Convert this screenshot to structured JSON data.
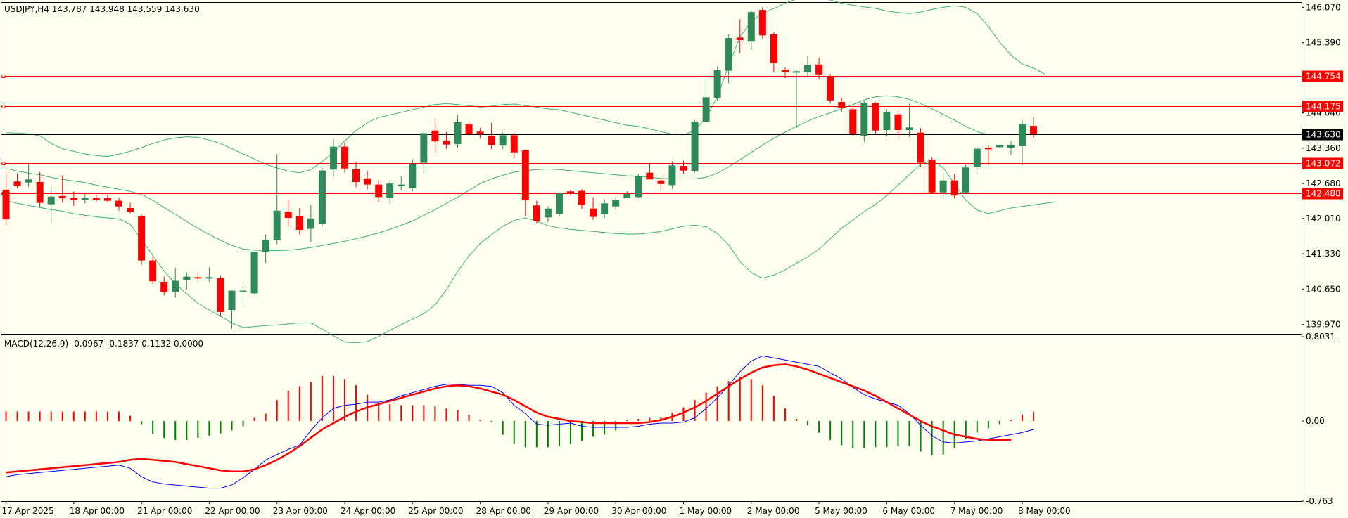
{
  "colors": {
    "background": "#fffff0",
    "bull": "#2e8b57",
    "bear": "#ff0000",
    "bands": "#3cb371",
    "hline": "#ff0000",
    "price_line": "#000000",
    "macd_line": "#0000ff",
    "signal_line": "#ff0000",
    "hist_pos": "#ff0000",
    "hist_neg": "#008000"
  },
  "chart_data": [
    {
      "type": "candlestick",
      "title": "USDJPY,H4  143.787 143.948 143.559 143.630",
      "ylim": [
        139.79,
        146.17
      ],
      "yticks": [
        146.07,
        145.39,
        144.04,
        143.36,
        142.68,
        142.01,
        141.33,
        140.65,
        139.97
      ],
      "ytick_labels": [
        "146.070",
        "145.390",
        "144.040",
        "143.360",
        "142.680",
        "142.010",
        "141.330",
        "140.650",
        "139.970"
      ],
      "horizontal_levels": [
        {
          "value": 144.754,
          "label": "144.754"
        },
        {
          "value": 144.175,
          "label": "144.175"
        },
        {
          "value": 143.072,
          "label": "143.072"
        },
        {
          "value": 142.488,
          "label": "142.488"
        }
      ],
      "current_price": {
        "value": 143.63,
        "label": "143.630"
      },
      "candles": [
        [
          142.56,
          142.92,
          141.88,
          141.99
        ],
        [
          142.72,
          142.88,
          142.59,
          142.64
        ],
        [
          142.7,
          143.05,
          142.61,
          142.76
        ],
        [
          142.71,
          142.9,
          142.23,
          142.31
        ],
        [
          142.28,
          142.62,
          141.92,
          142.43
        ],
        [
          142.44,
          142.84,
          142.31,
          142.4
        ],
        [
          142.4,
          142.53,
          142.25,
          142.37
        ],
        [
          142.37,
          142.49,
          142.3,
          142.4
        ],
        [
          142.4,
          142.47,
          142.32,
          142.36
        ],
        [
          142.4,
          142.46,
          142.32,
          142.35
        ],
        [
          142.35,
          142.41,
          142.16,
          142.24
        ],
        [
          142.21,
          142.31,
          142.11,
          142.14
        ],
        [
          142.06,
          142.1,
          141.11,
          141.2
        ],
        [
          141.2,
          141.28,
          140.75,
          140.8
        ],
        [
          140.79,
          140.89,
          140.53,
          140.59
        ],
        [
          140.6,
          141.05,
          140.49,
          140.81
        ],
        [
          140.83,
          140.98,
          140.64,
          140.89
        ],
        [
          140.88,
          140.97,
          140.8,
          140.87
        ],
        [
          140.86,
          141.07,
          140.79,
          140.88
        ],
        [
          140.86,
          140.92,
          140.14,
          140.21
        ],
        [
          140.25,
          140.63,
          139.89,
          140.62
        ],
        [
          140.61,
          140.71,
          140.3,
          140.62
        ],
        [
          140.57,
          141.37,
          140.55,
          141.36
        ],
        [
          141.37,
          141.7,
          141.15,
          141.6
        ],
        [
          141.59,
          143.25,
          141.51,
          142.16
        ],
        [
          142.14,
          142.36,
          141.85,
          142.02
        ],
        [
          142.06,
          142.21,
          141.7,
          141.79
        ],
        [
          141.81,
          142.27,
          141.56,
          142.01
        ],
        [
          141.9,
          142.98,
          141.85,
          142.93
        ],
        [
          142.95,
          143.53,
          142.81,
          143.39
        ],
        [
          143.39,
          143.46,
          142.89,
          142.97
        ],
        [
          142.96,
          143.1,
          142.61,
          142.71
        ],
        [
          142.78,
          142.92,
          142.57,
          142.66
        ],
        [
          142.66,
          142.75,
          142.33,
          142.42
        ],
        [
          142.4,
          142.74,
          142.3,
          142.68
        ],
        [
          142.65,
          142.82,
          142.55,
          142.66
        ],
        [
          142.59,
          143.15,
          142.53,
          143.06
        ],
        [
          143.08,
          143.7,
          142.88,
          143.65
        ],
        [
          143.7,
          143.92,
          143.27,
          143.49
        ],
        [
          143.51,
          143.67,
          143.35,
          143.43
        ],
        [
          143.44,
          144.0,
          143.37,
          143.86
        ],
        [
          143.82,
          143.87,
          143.61,
          143.63
        ],
        [
          143.68,
          143.75,
          143.55,
          143.64
        ],
        [
          143.6,
          143.85,
          143.34,
          143.42
        ],
        [
          143.41,
          143.66,
          143.34,
          143.61
        ],
        [
          143.61,
          143.65,
          143.17,
          143.28
        ],
        [
          143.32,
          143.33,
          142.05,
          142.36
        ],
        [
          142.26,
          142.35,
          141.92,
          141.96
        ],
        [
          142.03,
          142.24,
          141.94,
          142.2
        ],
        [
          142.1,
          142.51,
          142.04,
          142.49
        ],
        [
          142.53,
          142.56,
          142.45,
          142.51
        ],
        [
          142.54,
          142.57,
          142.19,
          142.27
        ],
        [
          142.2,
          142.41,
          141.98,
          142.04
        ],
        [
          142.09,
          142.38,
          142.02,
          142.3
        ],
        [
          142.24,
          142.43,
          142.17,
          142.37
        ],
        [
          142.4,
          142.53,
          142.41,
          142.48
        ],
        [
          142.42,
          142.86,
          142.41,
          142.82
        ],
        [
          142.89,
          143.08,
          142.76,
          142.76
        ],
        [
          142.74,
          142.78,
          142.55,
          142.67
        ],
        [
          142.65,
          143.11,
          142.58,
          143.03
        ],
        [
          143.02,
          143.12,
          142.87,
          142.93
        ],
        [
          142.92,
          143.9,
          142.89,
          143.87
        ],
        [
          143.87,
          144.73,
          143.86,
          144.34
        ],
        [
          144.33,
          144.93,
          144.26,
          144.86
        ],
        [
          144.85,
          145.55,
          144.61,
          145.48
        ],
        [
          145.49,
          145.84,
          145.19,
          145.44
        ],
        [
          145.41,
          146.0,
          145.25,
          145.98
        ],
        [
          146.02,
          146.07,
          145.46,
          145.53
        ],
        [
          145.55,
          145.59,
          144.82,
          145.0
        ],
        [
          144.87,
          144.91,
          144.71,
          144.82
        ],
        [
          144.82,
          144.87,
          143.75,
          144.84
        ],
        [
          144.82,
          145.13,
          144.73,
          144.96
        ],
        [
          144.97,
          145.1,
          144.68,
          144.78
        ],
        [
          144.74,
          144.79,
          144.22,
          144.28
        ],
        [
          144.25,
          144.33,
          144.06,
          144.14
        ],
        [
          144.11,
          144.14,
          143.6,
          143.64
        ],
        [
          143.6,
          144.27,
          143.48,
          144.24
        ],
        [
          144.23,
          144.25,
          143.62,
          143.7
        ],
        [
          143.71,
          144.11,
          143.59,
          144.06
        ],
        [
          144.01,
          144.09,
          143.58,
          143.71
        ],
        [
          143.71,
          144.21,
          143.58,
          143.76
        ],
        [
          143.66,
          143.74,
          143.0,
          143.08
        ],
        [
          143.14,
          143.18,
          142.49,
          142.51
        ],
        [
          142.51,
          142.87,
          142.38,
          142.74
        ],
        [
          142.74,
          142.87,
          142.4,
          142.45
        ],
        [
          142.51,
          143.04,
          142.48,
          142.99
        ],
        [
          143.0,
          143.39,
          142.93,
          143.35
        ],
        [
          143.37,
          143.41,
          143.04,
          143.34
        ],
        [
          143.38,
          143.39,
          143.36,
          143.42
        ],
        [
          143.37,
          143.51,
          143.23,
          143.42
        ],
        [
          143.4,
          143.89,
          143.03,
          143.83
        ],
        [
          143.79,
          143.95,
          143.56,
          143.63
        ]
      ],
      "bollinger": {
        "upper": [
          143.66,
          143.65,
          143.64,
          143.6,
          143.45,
          143.35,
          143.3,
          143.25,
          143.22,
          143.2,
          143.25,
          143.3,
          143.37,
          143.45,
          143.52,
          143.56,
          143.58,
          143.57,
          143.52,
          143.45,
          143.35,
          143.25,
          143.15,
          143.05,
          142.98,
          142.92,
          142.89,
          142.95,
          143.1,
          143.28,
          143.5,
          143.7,
          143.85,
          143.95,
          144.0,
          144.05,
          144.1,
          144.15,
          144.2,
          144.22,
          144.2,
          144.18,
          144.15,
          144.17,
          144.2,
          144.21,
          144.18,
          144.15,
          144.12,
          144.1,
          144.05,
          144.0,
          143.95,
          143.9,
          143.85,
          143.8,
          143.78,
          143.73,
          143.68,
          143.63,
          143.62,
          143.7,
          143.95,
          144.35,
          144.95,
          145.5,
          145.8,
          145.96,
          146.05,
          146.15,
          146.23,
          146.25,
          146.25,
          146.21,
          146.15,
          146.11,
          146.08,
          146.05,
          146.0,
          145.97,
          145.95,
          145.98,
          146.03,
          146.07,
          146.1,
          146.07,
          145.95,
          145.7,
          145.4,
          145.15,
          144.98,
          144.9,
          144.79
        ],
        "middle": [
          142.97,
          142.92,
          142.88,
          142.85,
          142.8,
          142.76,
          142.73,
          142.7,
          142.65,
          142.61,
          142.57,
          142.53,
          142.47,
          142.36,
          142.22,
          142.09,
          141.95,
          141.82,
          141.7,
          141.59,
          141.49,
          141.42,
          141.4,
          141.39,
          141.39,
          141.4,
          141.42,
          141.45,
          141.49,
          141.53,
          141.57,
          141.62,
          141.67,
          141.73,
          141.8,
          141.88,
          141.96,
          142.07,
          142.18,
          142.3,
          142.42,
          142.55,
          142.68,
          142.77,
          142.84,
          142.9,
          142.93,
          142.95,
          142.96,
          142.95,
          142.93,
          142.91,
          142.89,
          142.87,
          142.85,
          142.83,
          142.82,
          142.8,
          142.78,
          142.77,
          142.77,
          142.77,
          142.8,
          142.88,
          143.0,
          143.14,
          143.28,
          143.42,
          143.55,
          143.67,
          143.78,
          143.88,
          143.97,
          144.04,
          144.12,
          144.2,
          144.29,
          144.35,
          144.37,
          144.35,
          144.3,
          144.22,
          144.12,
          144.01,
          143.9,
          143.78,
          143.68,
          143.62
        ],
        "lower": [
          142.36,
          142.3,
          142.26,
          142.22,
          142.18,
          142.15,
          142.1,
          142.07,
          142.04,
          142.02,
          142.0,
          141.9,
          141.6,
          141.3,
          141.0,
          140.75,
          140.56,
          140.38,
          140.25,
          140.13,
          140.0,
          139.91,
          139.93,
          139.95,
          139.96,
          139.98,
          140.0,
          140.0,
          139.88,
          139.75,
          139.63,
          139.62,
          139.64,
          139.74,
          139.86,
          139.97,
          140.07,
          140.18,
          140.35,
          140.64,
          140.99,
          141.29,
          141.53,
          141.7,
          141.86,
          141.97,
          142.02,
          141.96,
          141.87,
          141.83,
          141.8,
          141.78,
          141.76,
          141.74,
          141.72,
          141.71,
          141.71,
          141.73,
          141.76,
          141.81,
          141.86,
          141.88,
          141.85,
          141.72,
          141.5,
          141.18,
          140.97,
          140.86,
          140.92,
          141.02,
          141.15,
          141.27,
          141.42,
          141.62,
          141.82,
          141.98,
          142.14,
          142.28,
          142.45,
          142.65,
          142.85,
          143.05,
          143.13,
          142.98,
          142.68,
          142.36,
          142.17,
          142.1,
          142.16,
          142.21,
          142.24,
          142.27,
          142.3,
          142.33
        ]
      }
    },
    {
      "type": "macd",
      "title": "MACD(12,26,9) -0.0967 -0.1837 0.1132 0.0000",
      "ylim": [
        -0.763,
        0.8031
      ],
      "yticks": [
        0.8031,
        0.0,
        -0.763
      ],
      "ytick_labels": [
        "0.8031",
        "0.00",
        "-0.763"
      ],
      "histogram": [
        0.09,
        0.09,
        0.09,
        0.09,
        0.09,
        0.09,
        0.09,
        0.09,
        0.09,
        0.09,
        0.09,
        0.05,
        -0.03,
        -0.12,
        -0.16,
        -0.18,
        -0.18,
        -0.16,
        -0.14,
        -0.12,
        -0.09,
        -0.05,
        0.03,
        0.07,
        0.2,
        0.29,
        0.33,
        0.37,
        0.43,
        0.43,
        0.4,
        0.34,
        0.25,
        0.17,
        0.16,
        0.15,
        0.15,
        0.15,
        0.14,
        0.12,
        0.1,
        0.06,
        0.01,
        -0.01,
        -0.13,
        -0.22,
        -0.25,
        -0.25,
        -0.25,
        -0.24,
        -0.22,
        -0.19,
        -0.15,
        -0.13,
        -0.09,
        0.01,
        0.02,
        0.03,
        0.04,
        0.08,
        0.13,
        0.2,
        0.27,
        0.33,
        0.38,
        0.42,
        0.4,
        0.34,
        0.24,
        0.12,
        0.02,
        -0.04,
        -0.11,
        -0.18,
        -0.23,
        -0.26,
        -0.26,
        -0.25,
        -0.25,
        -0.24,
        -0.24,
        -0.29,
        -0.33,
        -0.32,
        -0.26,
        -0.17,
        -0.11,
        -0.07,
        -0.03,
        0.01,
        0.06,
        0.09
      ],
      "macd": [
        -0.53,
        -0.51,
        -0.5,
        -0.49,
        -0.48,
        -0.47,
        -0.46,
        -0.45,
        -0.44,
        -0.43,
        -0.42,
        -0.45,
        -0.53,
        -0.58,
        -0.6,
        -0.61,
        -0.62,
        -0.63,
        -0.64,
        -0.64,
        -0.61,
        -0.54,
        -0.46,
        -0.37,
        -0.32,
        -0.27,
        -0.23,
        -0.09,
        0.03,
        0.12,
        0.15,
        0.16,
        0.18,
        0.18,
        0.2,
        0.24,
        0.27,
        0.3,
        0.33,
        0.35,
        0.35,
        0.34,
        0.34,
        0.33,
        0.27,
        0.15,
        0.07,
        -0.03,
        -0.04,
        -0.03,
        -0.02,
        -0.05,
        -0.06,
        -0.06,
        -0.06,
        -0.06,
        -0.05,
        -0.03,
        -0.02,
        -0.02,
        -0.01,
        0.03,
        0.12,
        0.22,
        0.34,
        0.47,
        0.57,
        0.62,
        0.6,
        0.58,
        0.56,
        0.54,
        0.52,
        0.46,
        0.4,
        0.32,
        0.25,
        0.21,
        0.18,
        0.15,
        0.07,
        -0.04,
        -0.14,
        -0.2,
        -0.21,
        -0.2,
        -0.19,
        -0.17,
        -0.15,
        -0.13,
        -0.11,
        -0.08
      ],
      "signal": [
        -0.49,
        -0.48,
        -0.47,
        -0.46,
        -0.45,
        -0.44,
        -0.43,
        -0.42,
        -0.41,
        -0.4,
        -0.39,
        -0.37,
        -0.36,
        -0.37,
        -0.38,
        -0.39,
        -0.41,
        -0.43,
        -0.45,
        -0.47,
        -0.48,
        -0.48,
        -0.46,
        -0.42,
        -0.37,
        -0.31,
        -0.24,
        -0.16,
        -0.08,
        -0.02,
        0.04,
        0.09,
        0.13,
        0.16,
        0.19,
        0.22,
        0.25,
        0.28,
        0.31,
        0.33,
        0.34,
        0.33,
        0.31,
        0.28,
        0.25,
        0.2,
        0.14,
        0.08,
        0.04,
        0.02,
        0.0,
        -0.01,
        -0.02,
        -0.02,
        -0.02,
        -0.02,
        -0.02,
        -0.01,
        0.01,
        0.04,
        0.08,
        0.13,
        0.19,
        0.26,
        0.33,
        0.4,
        0.46,
        0.51,
        0.53,
        0.54,
        0.52,
        0.49,
        0.45,
        0.41,
        0.37,
        0.33,
        0.29,
        0.24,
        0.18,
        0.12,
        0.06,
        0.0,
        -0.05,
        -0.09,
        -0.13,
        -0.15,
        -0.17,
        -0.18,
        -0.18,
        -0.18
      ]
    },
    {
      "type": "time_axis",
      "x_labels": [
        "17 Apr 2025",
        "18 Apr 00:00",
        "21 Apr 00:00",
        "22 Apr 00:00",
        "23 Apr 00:00",
        "24 Apr 00:00",
        "25 Apr 00:00",
        "28 Apr 00:00",
        "29 Apr 00:00",
        "30 Apr 00:00",
        "1 May 00:00",
        "2 May 00:00",
        "5 May 00:00",
        "6 May 00:00",
        "7 May 00:00",
        "8 May 00:00"
      ],
      "x_label_bars": [
        0,
        6,
        12,
        18,
        24,
        30,
        36,
        42,
        48,
        54,
        60,
        66,
        72,
        78,
        84,
        90
      ]
    }
  ]
}
